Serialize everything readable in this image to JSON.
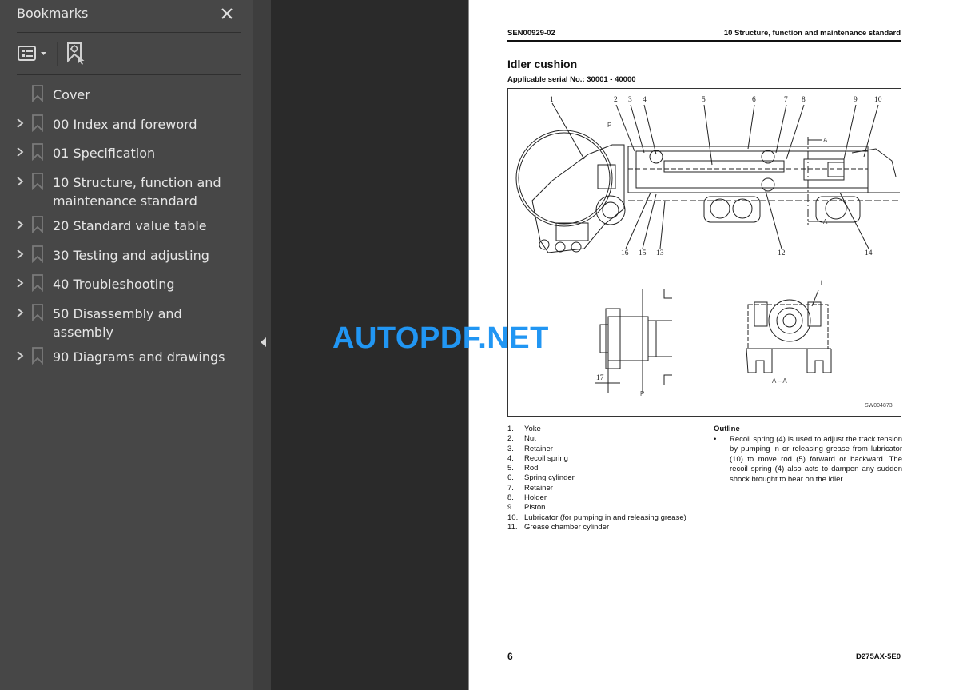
{
  "sidebar": {
    "title": "Bookmarks",
    "close_icon": "close-icon",
    "toolbar": {
      "options_icon": "bookmark-options-icon",
      "find_icon": "find-current-bookmark-icon"
    },
    "items": [
      {
        "label": "Cover",
        "expandable": false
      },
      {
        "label": "00 Index and foreword",
        "expandable": true
      },
      {
        "label": "01 Specification",
        "expandable": true
      },
      {
        "label": "10 Structure, function and maintenance standard",
        "expandable": true
      },
      {
        "label": "20 Standard value table",
        "expandable": true
      },
      {
        "label": "30 Testing and adjusting",
        "expandable": true
      },
      {
        "label": "40 Troubleshooting",
        "expandable": true
      },
      {
        "label": "50 Disassembly and assembly",
        "expandable": true
      },
      {
        "label": "90 Diagrams and drawings",
        "expandable": true
      }
    ],
    "collapse_icon": "collapse-panel-icon"
  },
  "document": {
    "header_left": "SEN00929-02",
    "header_right": "10 Structure, function and maintenance standard",
    "section_title": "Idler cushion",
    "serial": "Applicable serial No.: 30001 - 40000",
    "figure": {
      "callouts_top": [
        "1",
        "2",
        "3",
        "4",
        "5",
        "6",
        "7",
        "8",
        "9",
        "10"
      ],
      "callouts_bottom": [
        "16",
        "15",
        "13",
        "12",
        "14"
      ],
      "view_p_label": "P",
      "view_aa_label": "A – A",
      "section_marker": "A",
      "callout_11": "11",
      "callout_17": "17",
      "figure_code": "SW004873"
    },
    "parts": [
      {
        "num": "1.",
        "name": "Yoke"
      },
      {
        "num": "2.",
        "name": "Nut"
      },
      {
        "num": "3.",
        "name": "Retainer"
      },
      {
        "num": "4.",
        "name": "Recoil spring"
      },
      {
        "num": "5.",
        "name": "Rod"
      },
      {
        "num": "6.",
        "name": "Spring cylinder"
      },
      {
        "num": "7.",
        "name": "Retainer"
      },
      {
        "num": "8.",
        "name": "Holder"
      },
      {
        "num": "9.",
        "name": "Piston"
      },
      {
        "num": "10.",
        "name": "Lubricator (for pumping in and releasing grease)"
      },
      {
        "num": "11.",
        "name": "Grease chamber cylinder"
      }
    ],
    "outline_title": "Outline",
    "outline_bullet": "•",
    "outline_text": "Recoil spring (4) is used to adjust the track tension by pumping in or releasing grease from lubricator (10) to move rod (5) forward or backward. The recoil spring (4) also acts to dampen any sudden shock brought to bear on the idler.",
    "page_number": "6",
    "model": "D275AX-5E0"
  },
  "watermark": "AUTOPDF.NET"
}
